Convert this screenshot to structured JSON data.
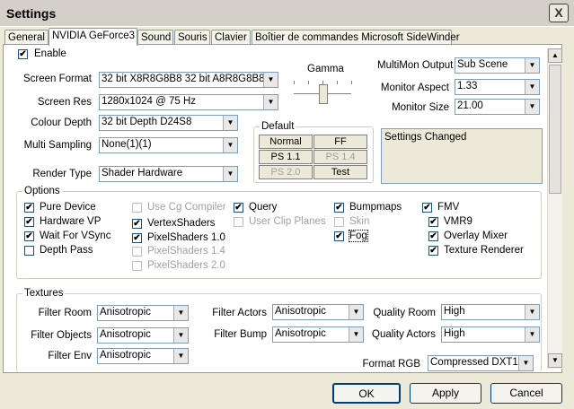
{
  "window": {
    "title": "Settings",
    "close": "X"
  },
  "tabs": [
    {
      "label": "General"
    },
    {
      "label": "NVIDIA GeForce3"
    },
    {
      "label": "Sound"
    },
    {
      "label": "Souris"
    },
    {
      "label": "Clavier"
    },
    {
      "label": "Boîtier de commandes Microsoft SideWinder"
    }
  ],
  "enable": {
    "label": "Enable",
    "checked": true
  },
  "display": {
    "screen_format_label": "Screen Format",
    "screen_format_value": "32 bit X8R8G8B8 32 bit A8R8G8B8",
    "screen_res_label": "Screen Res",
    "screen_res_value": "1280x1024 @ 75 Hz",
    "colour_depth_label": "Colour Depth",
    "colour_depth_value": "32 bit Depth D24S8",
    "multi_sampling_label": "Multi Sampling",
    "multi_sampling_value": "None(1)(1)",
    "render_type_label": "Render Type",
    "render_type_value": "Shader Hardware",
    "gamma_label": "Gamma"
  },
  "default_group": {
    "title": "Default",
    "buttons": [
      "Normal",
      "FF",
      "PS 1.1",
      "PS 1.4",
      "PS 2.0",
      "Test"
    ]
  },
  "monitor": {
    "multimon_label": "MultiMon Output",
    "multimon_value": "Sub Scene",
    "aspect_label": "Monitor Aspect",
    "aspect_value": "1.33",
    "size_label": "Monitor Size",
    "size_value": "21.00",
    "status_text": "Settings Changed"
  },
  "options": {
    "title": "Options",
    "col1": [
      {
        "label": "Pure Device",
        "checked": true,
        "disabled": false
      },
      {
        "label": "Hardware VP",
        "checked": true,
        "disabled": false
      },
      {
        "label": "Wait For VSync",
        "checked": true,
        "disabled": false
      },
      {
        "label": "Depth Pass",
        "checked": false,
        "disabled": false
      }
    ],
    "col2": [
      {
        "label": "Use Cg Compiler",
        "checked": false,
        "disabled": true
      },
      {
        "label": "VertexShaders",
        "checked": true,
        "disabled": false
      },
      {
        "label": "PixelShaders 1.0",
        "checked": true,
        "disabled": false
      },
      {
        "label": "PixelShaders 1.4",
        "checked": false,
        "disabled": true
      },
      {
        "label": "PixelShaders 2.0",
        "checked": false,
        "disabled": true
      }
    ],
    "col3": [
      {
        "label": "Query",
        "checked": true,
        "disabled": false
      },
      {
        "label": "User Clip Planes",
        "checked": false,
        "disabled": true
      }
    ],
    "col4": [
      {
        "label": "Bumpmaps",
        "checked": true,
        "disabled": false
      },
      {
        "label": "Skin",
        "checked": false,
        "disabled": true
      },
      {
        "label": "Fog",
        "checked": true,
        "disabled": false
      }
    ],
    "col5": [
      {
        "label": "FMV",
        "checked": true,
        "disabled": false
      },
      {
        "label": "VMR9",
        "checked": true,
        "disabled": false
      },
      {
        "label": "Overlay Mixer",
        "checked": true,
        "disabled": false
      },
      {
        "label": "Texture Renderer",
        "checked": true,
        "disabled": false
      }
    ]
  },
  "textures": {
    "title": "Textures",
    "filter_room_label": "Filter Room",
    "filter_room_value": "Anisotropic",
    "filter_objects_label": "Filter Objects",
    "filter_objects_value": "Anisotropic",
    "filter_env_label": "Filter Env",
    "filter_env_value": "Anisotropic",
    "filter_actors_label": "Filter Actors",
    "filter_actors_value": "Anisotropic",
    "filter_bump_label": "Filter Bump",
    "filter_bump_value": "Anisotropic",
    "quality_room_label": "Quality Room",
    "quality_room_value": "High",
    "quality_actors_label": "Quality Actors",
    "quality_actors_value": "High",
    "format_rgb_label": "Format RGB",
    "format_rgb_value": "Compressed DXT1"
  },
  "footer": {
    "ok": "OK",
    "apply": "Apply",
    "cancel": "Cancel"
  },
  "icons": {
    "check": "✔",
    "dropdown": "▼",
    "scroll_up": "▲",
    "scroll_down": "▼"
  }
}
